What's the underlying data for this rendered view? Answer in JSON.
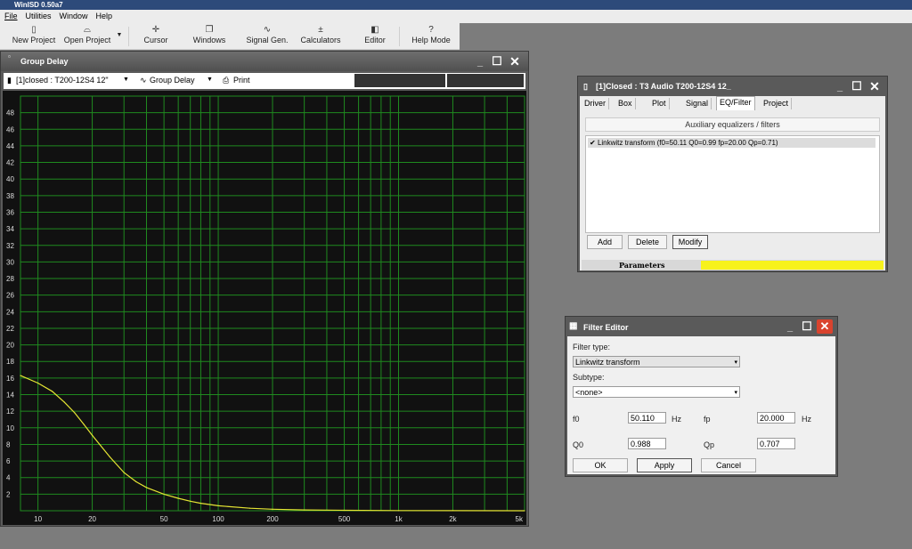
{
  "app": {
    "title": "WinISD 0.50a7"
  },
  "menu": [
    "File",
    "Utilities",
    "Window",
    "Help"
  ],
  "toolbar": [
    {
      "label": "New Project",
      "icon": "new-project-icon",
      "glyph": "▯"
    },
    {
      "label": "Open Project",
      "icon": "open-project-icon",
      "glyph": "⌓"
    },
    {
      "label": "Cursor",
      "icon": "cursor-icon",
      "glyph": "✛"
    },
    {
      "label": "Windows",
      "icon": "windows-icon",
      "glyph": "❐"
    },
    {
      "label": "Signal Gen.",
      "icon": "signal-gen-icon",
      "glyph": "∿"
    },
    {
      "label": "Calculators",
      "icon": "calculators-icon",
      "glyph": "±"
    },
    {
      "label": "Editor",
      "icon": "editor-icon",
      "glyph": "◧"
    },
    {
      "label": "Help Mode",
      "icon": "help-icon",
      "glyph": "?"
    }
  ],
  "group_delay": {
    "title": "Group Delay",
    "project_select": "[1]closed : T200-12S4 12\"",
    "graph_select": "Group Delay",
    "print_label": "Print"
  },
  "chart_data": {
    "type": "line",
    "title": "",
    "xlabel": "",
    "ylabel": "",
    "x_scale": "log",
    "xlim": [
      8,
      5000
    ],
    "ylim": [
      0,
      50
    ],
    "x_ticks": [
      "10",
      "20",
      "50",
      "100",
      "200",
      "500",
      "1k",
      "2k",
      "5k"
    ],
    "y_ticks": [
      "2",
      "4",
      "6",
      "8",
      "10",
      "12",
      "14",
      "16",
      "18",
      "20",
      "22",
      "24",
      "26",
      "28",
      "30",
      "32",
      "34",
      "36",
      "38",
      "40",
      "42",
      "44",
      "46",
      "48"
    ],
    "grid": true,
    "series": [
      {
        "color": "#e5e533",
        "x": [
          8,
          10,
          12,
          14,
          16,
          18,
          20,
          25,
          30,
          35,
          40,
          50,
          60,
          70,
          80,
          100,
          150,
          200,
          300,
          500,
          1000,
          2000,
          5000
        ],
        "y": [
          16.3,
          15.4,
          14.4,
          13.1,
          11.8,
          10.4,
          9.1,
          6.5,
          4.6,
          3.5,
          2.8,
          2.0,
          1.5,
          1.15,
          0.9,
          0.6,
          0.3,
          0.18,
          0.1,
          0.05,
          0.02,
          0.01,
          0.0
        ]
      }
    ]
  },
  "driver": {
    "title": "[1]Closed : T3 Audio T200-12S4 12_",
    "tabs": [
      "Driver",
      "Box",
      "Plot",
      "Signal",
      "EQ/Filter",
      "Project"
    ],
    "active_tab": "EQ/Filter",
    "section": "Auxiliary equalizers / filters",
    "items": [
      "Linkwitz transform (f0=50.11 Q0=0.99 fp=20.00 Qp=0.71)"
    ],
    "buttons": [
      "Add",
      "Delete",
      "Modify"
    ],
    "parameters_label": "Parameters",
    "parameters_color": "#f7f21c"
  },
  "filter_editor": {
    "title": "Filter Editor",
    "filter_type_label": "Filter type:",
    "filter_type_value": "Linkwitz transform",
    "subtype_label": "Subtype:",
    "subtype_value": "<none>",
    "f0_label": "f0",
    "f0_value": "50.110",
    "f0_unit": "Hz",
    "fp_label": "fp",
    "fp_value": "20.000",
    "fp_unit": "Hz",
    "q0_label": "Q0",
    "q0_value": "0.988",
    "qp_label": "Qp",
    "qp_value": "0.707",
    "ok": "OK",
    "apply": "Apply",
    "cancel": "Cancel"
  }
}
